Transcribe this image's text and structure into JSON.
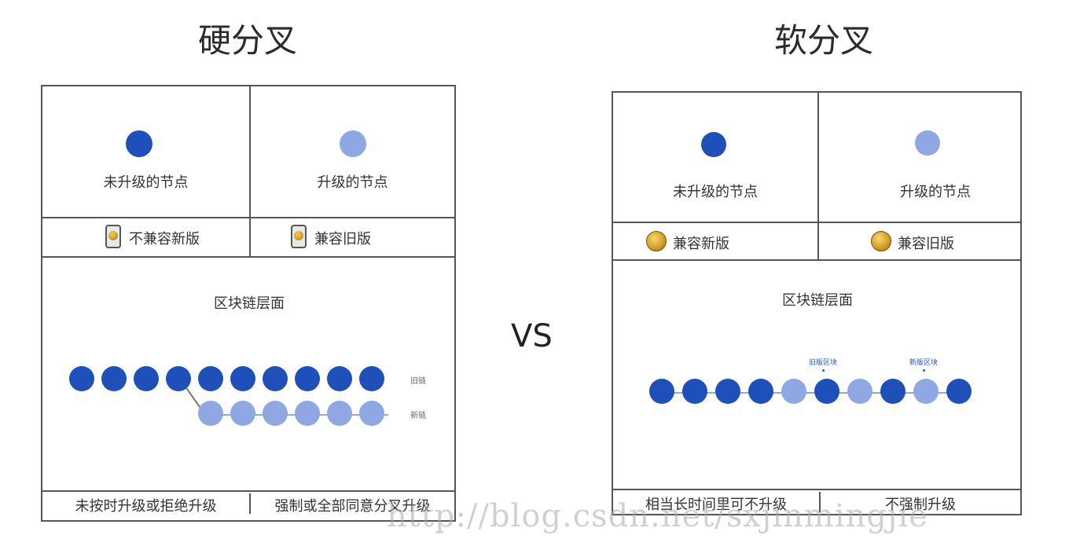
{
  "hard_fork": {
    "title": "硬分叉",
    "old_node_label": "未升级的节点",
    "new_node_label": "升级的节点",
    "old_compat": "不兼容新版",
    "new_compat": "兼容旧版",
    "chain_heading": "区块链层面",
    "old_chain_label": "旧链",
    "new_chain_label": "新链",
    "footer_left": "未按时升级或拒绝升级",
    "footer_right": "强制或全部同意分叉升级"
  },
  "soft_fork": {
    "title": "软分叉",
    "old_node_label": "未升级的节点",
    "new_node_label": "升级的节点",
    "old_compat": "兼容新版",
    "new_compat": "兼容旧版",
    "chain_heading": "区块链层面",
    "annotation_1": "旧版区块",
    "annotation_2": "新版区块",
    "footer_left": "相当长时间里可不升级",
    "footer_right": "不强制升级",
    "chain_pattern": [
      "dark",
      "dark",
      "dark",
      "dark",
      "light",
      "dark",
      "light",
      "dark",
      "light",
      "dark"
    ]
  },
  "vs_label": "VS",
  "watermark": "http://blog.csdn.net/sxjinmingjie",
  "colors": {
    "old_node": "#1f4fb8",
    "new_node": "#8fa7e2",
    "border": "#555555"
  }
}
